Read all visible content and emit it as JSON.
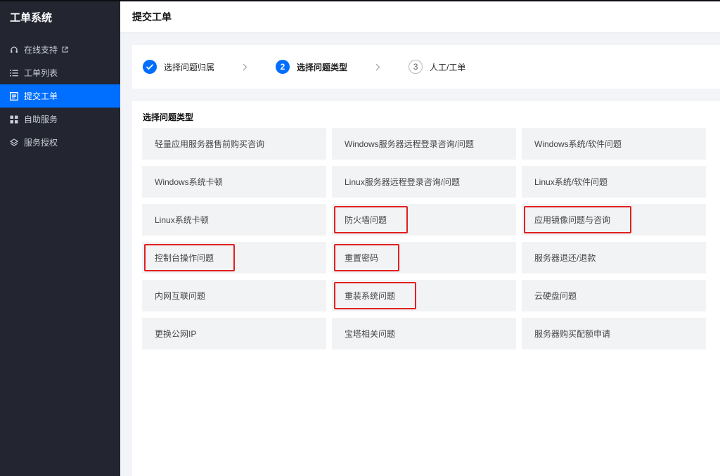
{
  "app": {
    "title": "工单系统"
  },
  "sidebar": {
    "items": [
      {
        "label": "在线支持",
        "icon": "headset-icon",
        "external": true,
        "active": false
      },
      {
        "label": "工单列表",
        "icon": "list-icon",
        "active": false
      },
      {
        "label": "提交工单",
        "icon": "form-icon",
        "active": true
      },
      {
        "label": "自助服务",
        "icon": "grid-icon",
        "active": false
      },
      {
        "label": "服务授权",
        "icon": "layers-icon",
        "active": false
      }
    ]
  },
  "header": {
    "title": "提交工单"
  },
  "steps": [
    {
      "index": "1",
      "label": "选择问题归属",
      "state": "done"
    },
    {
      "index": "2",
      "label": "选择问题类型",
      "state": "current"
    },
    {
      "index": "3",
      "label": "人工/工单",
      "state": "todo"
    }
  ],
  "section": {
    "title": "选择问题类型",
    "items": [
      "轻量应用服务器售前购买咨询",
      "Windows服务器远程登录咨询/问题",
      "Windows系统/软件问题",
      "Windows系统卡顿",
      "Linux服务器远程登录咨询/问题",
      "Linux系统/软件问题",
      "Linux系统卡顿",
      "防火墙问题",
      "应用镜像问题与咨询",
      "控制台操作问题",
      "重置密码",
      "服务器退还/退款",
      "内网互联问题",
      "重装系统问题",
      "云硬盘问题",
      "更换公网IP",
      "宝塔相关问题",
      "服务器购买配额申请"
    ]
  },
  "colors": {
    "accent": "#006eff",
    "sidebar_bg": "#232631",
    "highlight_border": "#e02020"
  }
}
